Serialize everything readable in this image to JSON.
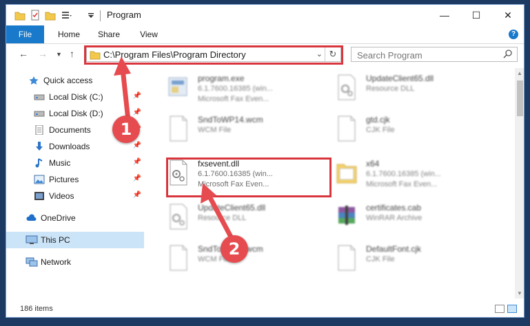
{
  "window": {
    "title": "Program"
  },
  "ribbon": {
    "tabs": [
      "File",
      "Home",
      "Share",
      "View"
    ]
  },
  "address": {
    "path": "C:\\Program Files\\Program Directory"
  },
  "search": {
    "placeholder": "Search Program"
  },
  "nav": {
    "items": [
      {
        "label": "Quick access",
        "icon": "star-icon",
        "pinned": false
      },
      {
        "label": "Local Disk (C:)",
        "icon": "drive-icon",
        "pinned": true
      },
      {
        "label": "Local Disk (D:)",
        "icon": "drive-icon",
        "pinned": true
      },
      {
        "label": "Documents",
        "icon": "documents-icon",
        "pinned": true
      },
      {
        "label": "Downloads",
        "icon": "download-icon",
        "pinned": true
      },
      {
        "label": "Music",
        "icon": "music-icon",
        "pinned": true
      },
      {
        "label": "Pictures",
        "icon": "pictures-icon",
        "pinned": true
      },
      {
        "label": "Videos",
        "icon": "videos-icon",
        "pinned": true
      },
      {
        "label": "OneDrive",
        "icon": "cloud-icon",
        "pinned": false
      },
      {
        "label": "This PC",
        "icon": "computer-icon",
        "pinned": false
      },
      {
        "label": "Network",
        "icon": "network-icon",
        "pinned": false
      }
    ]
  },
  "files": [
    {
      "name": "program.exe",
      "line2": "6.1.7600.16385 (win...",
      "line3": "Microsoft  Fax Even...",
      "icon": "exe-icon"
    },
    {
      "name": "UpdateClient65.dll",
      "line2": "Resource DLL",
      "line3": "",
      "icon": "dll-icon"
    },
    {
      "name": "SndToWP14.wcm",
      "line2": "WCM File",
      "line3": "",
      "icon": "file-icon"
    },
    {
      "name": "gtd.cjk",
      "line2": "CJK File",
      "line3": "",
      "icon": "file-icon"
    },
    {
      "name": "fxsevent.dll",
      "line2": "6.1.7600.16385 (win...",
      "line3": "Microsoft  Fax Even...",
      "icon": "dll-icon"
    },
    {
      "name": "x64",
      "line2": "6.1.7600.16385 (win...",
      "line3": "Microsoft  Fax Even...",
      "icon": "folder-icon"
    },
    {
      "name": "UpdateClient65.dll",
      "line2": "Resource DLL",
      "line3": "",
      "icon": "dll-icon"
    },
    {
      "name": "certificates.cab",
      "line2": "WinRAR Archive",
      "line3": "",
      "icon": "winrar-icon"
    },
    {
      "name": "SndToWP14.wcm",
      "line2": "WCM File",
      "line3": "",
      "icon": "file-icon"
    },
    {
      "name": "DefaultFont.cjk",
      "line2": "CJK File",
      "line3": "",
      "icon": "file-icon"
    }
  ],
  "status": {
    "count": "186 items"
  },
  "annotations": {
    "badge1": "1",
    "badge2": "2"
  },
  "colors": {
    "accent": "#1979ca",
    "highlight": "#d9353d",
    "badge": "#e64b4f",
    "selection": "#cce4f7"
  }
}
